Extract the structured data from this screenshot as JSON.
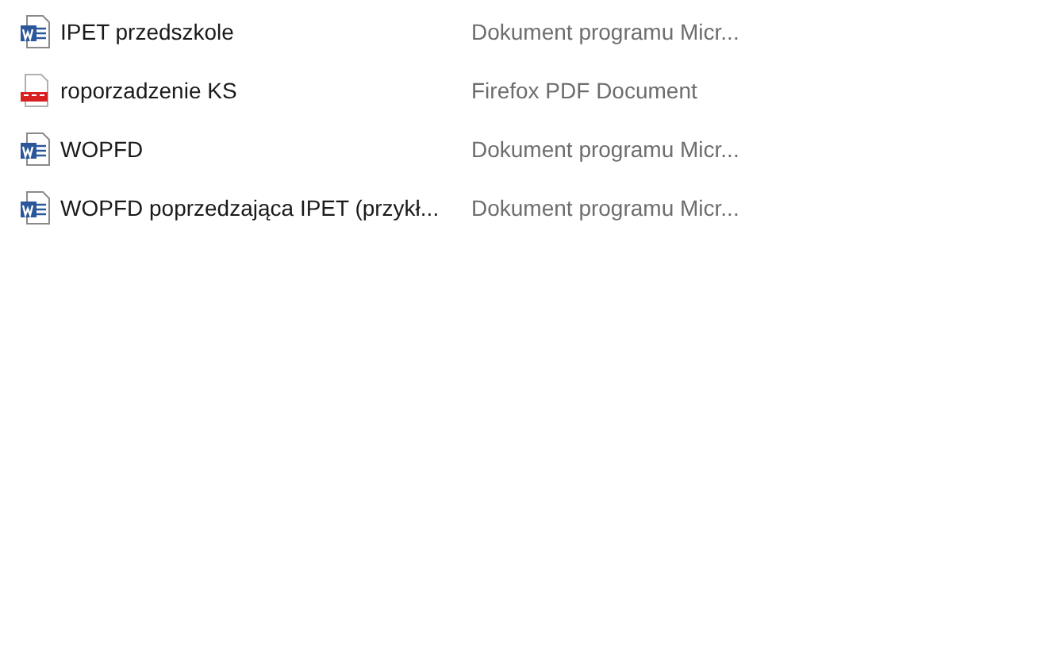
{
  "files": [
    {
      "name": "IPET przedszkole",
      "kind": "word",
      "type": "Dokument programu Micr..."
    },
    {
      "name": "roporzadzenie KS",
      "kind": "pdf",
      "type": "Firefox PDF Document"
    },
    {
      "name": "WOPFD",
      "kind": "word",
      "type": "Dokument programu Micr..."
    },
    {
      "name": "WOPFD poprzedzająca IPET (przykł...",
      "kind": "word",
      "type": "Dokument programu Micr..."
    }
  ]
}
